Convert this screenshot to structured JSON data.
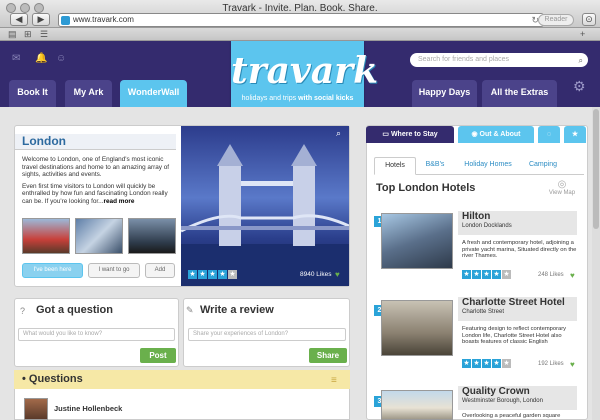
{
  "window": {
    "title": "Travark - Invite. Plan. Book. Share.",
    "url": "www.travark.com",
    "reader_label": "Reader"
  },
  "logo": {
    "name": "travark",
    "tagline_1": "holidays and trips",
    "tagline_2": "with social kicks"
  },
  "nav": {
    "tabs": [
      {
        "label": "Book It"
      },
      {
        "label": "My Ark"
      },
      {
        "label": "WonderWall"
      },
      {
        "label": "Happy Days"
      },
      {
        "label": "All the Extras"
      }
    ]
  },
  "search": {
    "placeholder": "Search for friends and places"
  },
  "city": {
    "name": "London",
    "intro": "Welcome to London, one of England's most iconic travel destinations and home to an amazing array of sights, activities and events.",
    "more_text": "Even first time visitors to London will quickly be enthralled by how fun and fascinating London really can be. If you're looking for...",
    "more_link": "read more",
    "btn_been": "I've been here",
    "btn_want": "I want to go",
    "btn_add": "Add",
    "likes": "8940 Likes",
    "rating": 4
  },
  "question": {
    "title": "Got a question",
    "placeholder": "What would you like to know?",
    "button": "Post"
  },
  "review": {
    "title": "Write a review",
    "placeholder": "Share your experiences of London?",
    "button": "Share"
  },
  "questions": {
    "title": "Questions",
    "author": "Justine Hollenbeck"
  },
  "right_tabs": {
    "where": "Where to Stay",
    "out": "Out & About"
  },
  "sub_tabs": [
    {
      "label": "Hotels"
    },
    {
      "label": "B&B's"
    },
    {
      "label": "Holiday Homes"
    },
    {
      "label": "Camping"
    }
  ],
  "hotels_title": "Top London Hotels",
  "view_map": "View Map",
  "hotels": [
    {
      "num": "1",
      "name": "Hilton",
      "location": "London Docklands",
      "desc": "A fresh and contemporary hotel, adjoining a private yacht marina, Situated directly on the river Thames.",
      "likes": "248 Likes",
      "rating": 4
    },
    {
      "num": "2",
      "name": "Charlotte Street Hotel",
      "location": "Charlotte Street",
      "desc": "Featuring design to reflect contemporary London life, Charlotte Street Hotel also boasts features of classic English",
      "likes": "192 Likes",
      "rating": 4
    },
    {
      "num": "3",
      "name": "Quality Crown",
      "location": "Westminster Borough, London",
      "desc": "Overlooking a peaceful garden square",
      "likes": "",
      "rating": 4
    }
  ]
}
